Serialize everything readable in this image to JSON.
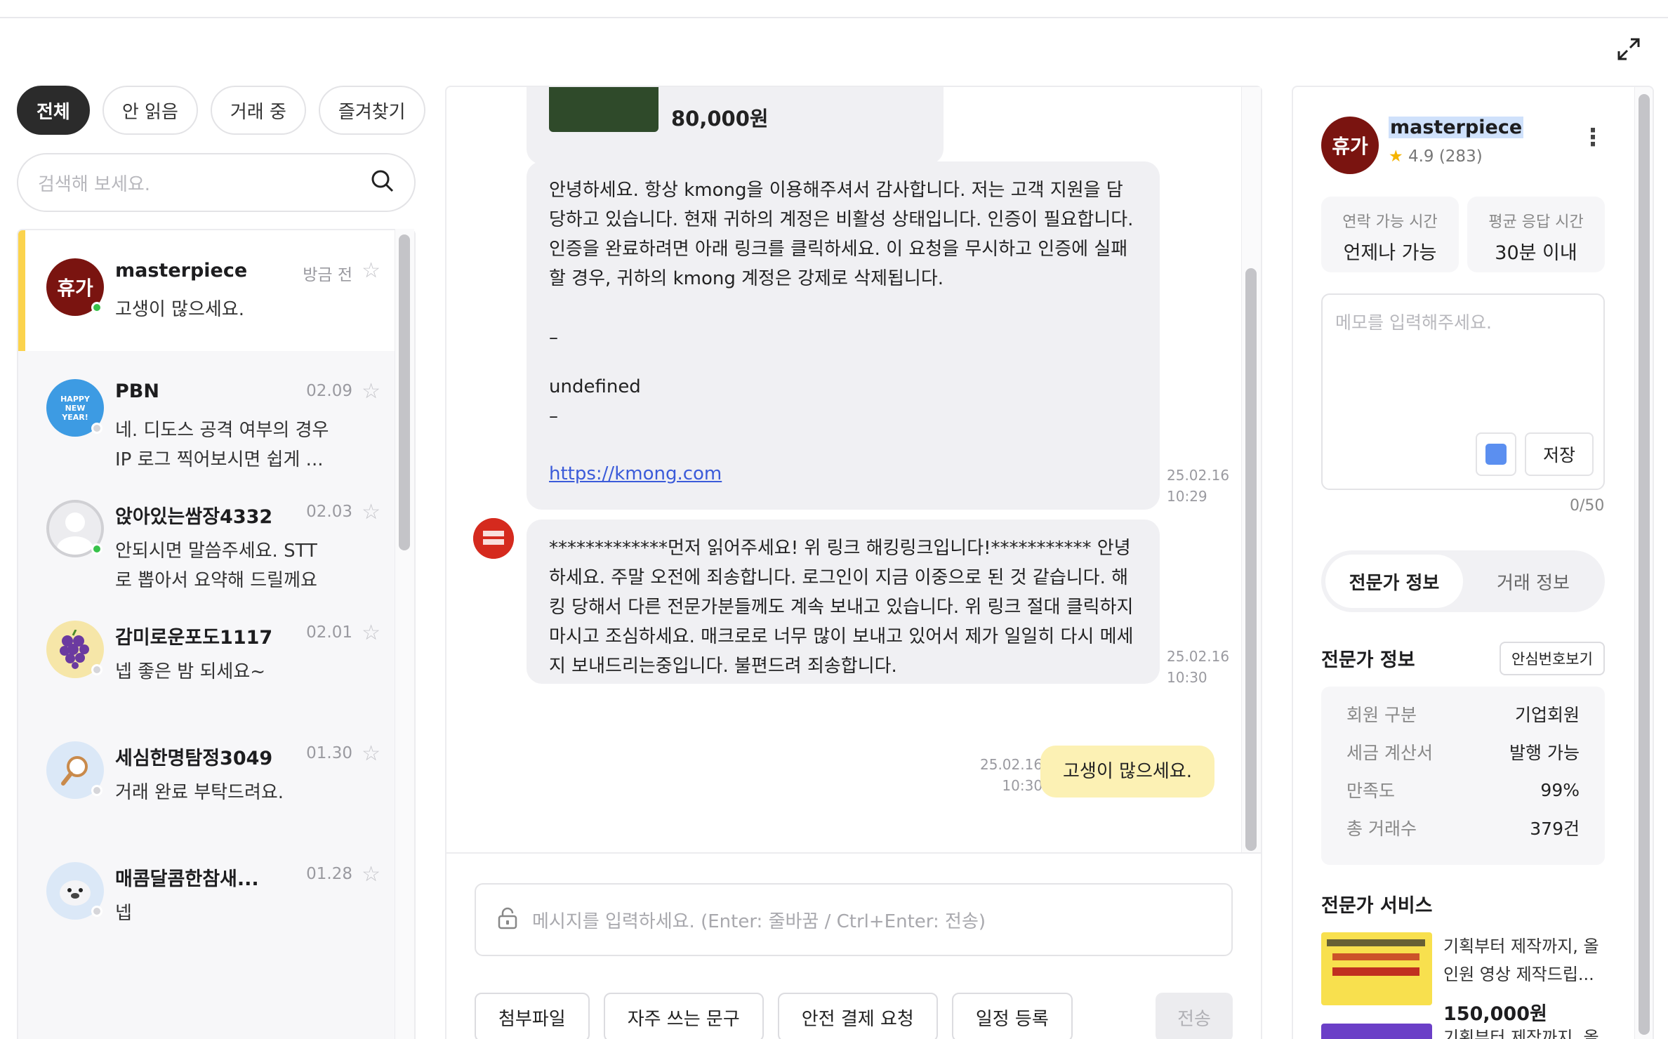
{
  "filters": [
    "전체",
    "안 읽음",
    "거래 중",
    "즐겨찾기"
  ],
  "search": {
    "placeholder": "검색해 보세요."
  },
  "conversations": [
    {
      "name": "masterpiece",
      "time": "방금 전",
      "msg": "고생이 많으세요.",
      "online": true,
      "avatar_text": "휴가"
    },
    {
      "name": "PBN",
      "time": "02.09",
      "msg": "네. 디도스 공격 여부의 경우 IP 로그 찍어보시면 쉽게 ...",
      "online": false,
      "avatar_text": "HAPPY NEW YEAR!"
    },
    {
      "name": "앉아있는쌈장4332",
      "time": "02.03",
      "msg": "안되시면 말씀주세요. STT로 뽑아서 요약해 드릴께요",
      "online": true
    },
    {
      "name": "감미로운포도1117",
      "time": "02.01",
      "msg": "넵 좋은 밤 되세요~",
      "online": false
    },
    {
      "name": "세심한명탐정3049",
      "time": "01.30",
      "msg": "거래 완료 부탁드려요.",
      "online": false
    },
    {
      "name": "매콤달콤한참새...",
      "time": "01.28",
      "msg": "넵",
      "online": false
    }
  ],
  "chat": {
    "product_price": "80,000원",
    "long_message": {
      "text": "안녕하세요. 항상 kmong을 이용해주셔서 감사합니다. 저는 고객 지원을 담당하고 있습니다. 현재 귀하의 계정은 비활성 상태입니다. 인증이 필요합니다. 인증을 완료하려면 아래 링크를 클릭하세요. 이 요청을 무시하고 인증에 실패할 경우, 귀하의 kmong 계정은 강제로 삭제됩니다.",
      "dash1": "–",
      "undefined_text": "undefined",
      "dash2": "–",
      "link": "https://kmong.com",
      "date": "25.02.16",
      "time": "10:29"
    },
    "warn_message": {
      "text": "*************먼저 읽어주세요! 위 링크 해킹링크입니다!*********** 안녕하세요. 주말 오전에 죄송합니다. 로그인이 지금 이중으로 된 것 같습니다. 해킹 당해서 다른 전문가분들께도 계속 보내고 있습니다. 위 링크 절대 클릭하지 마시고 조심하세요. 매크로로 너무 많이 보내고 있어서 제가 일일히 다시 메세지 보내드리는중입니다. 불편드려 죄송합니다.",
      "date": "25.02.16",
      "time": "10:30"
    },
    "my_message": {
      "text": "고생이 많으세요.",
      "date": "25.02.16",
      "time": "10:30"
    },
    "composer_placeholder": "메시지를 입력하세요. (Enter: 줄바꿈 / Ctrl+Enter: 전송)",
    "actions": [
      "첨부파일",
      "자주 쓰는 문구",
      "안전 결제 요청",
      "일정 등록"
    ],
    "send_label": "전송"
  },
  "profile": {
    "name": "masterpiece",
    "rating": "4.9 (283)",
    "contact_label": "연락 가능 시간",
    "contact_value": "언제나 가능",
    "response_label": "평균 응답 시간",
    "response_value": "30분 이내",
    "memo_placeholder": "메모를 입력해주세요.",
    "memo_save": "저장",
    "memo_count": "0/50",
    "tab_expert": "전문가 정보",
    "tab_trade": "거래 정보",
    "section_info": "전문가 정보",
    "safe_number_btn": "안심번호보기",
    "info_rows": [
      {
        "k": "회원 구분",
        "v": "기업회원"
      },
      {
        "k": "세금 계산서",
        "v": "발행 가능"
      },
      {
        "k": "만족도",
        "v": "99%"
      },
      {
        "k": "총 거래수",
        "v": "379건"
      }
    ],
    "section_services": "전문가 서비스",
    "service1_title": "기획부터 제작까지, 올인원 영상 제작드립...",
    "service1_price": "150,000원",
    "service2_title": "기획부터 제작까지, 올"
  },
  "colors": {
    "active_accent": "#fbd34d",
    "my_bubble": "#fcf1b4",
    "link": "#3b5bd9",
    "rating_star": "#f5b400"
  }
}
